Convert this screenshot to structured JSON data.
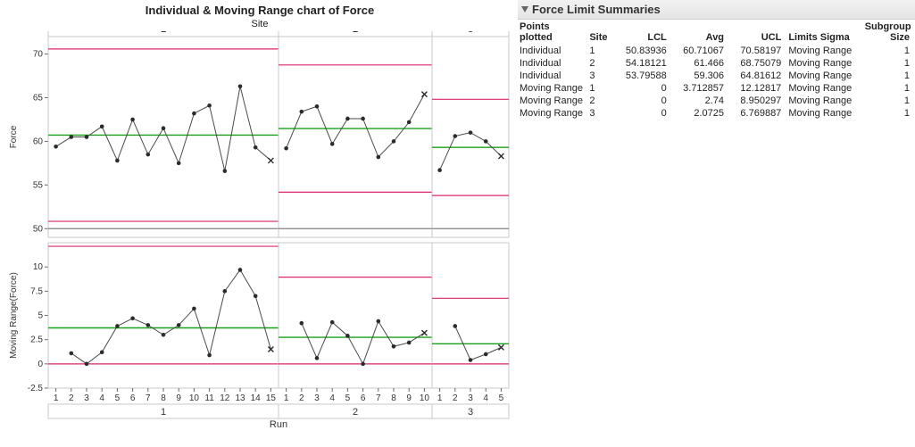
{
  "title": "Individual & Moving Range chart of Force",
  "top_group_label": "Site",
  "y_label_top": "Force",
  "y_label_bottom": "Moving Range(Force)",
  "x_label": "Run",
  "colors": {
    "limit": "#d8276d",
    "center": "#1aa01a",
    "spec": "#808080",
    "point_stroke": "#4a4a4a",
    "point_fill": "#2b2b2b",
    "axis": "#666666",
    "panel_border": "#c8c8c8"
  },
  "chart_data": {
    "type": "line",
    "rows": [
      {
        "label": "Individual",
        "ylabel": "Force",
        "ylim": [
          49,
          72
        ],
        "yticks": [
          50,
          55,
          60,
          65,
          70
        ],
        "spec_line": 50,
        "panels": [
          {
            "site": "1",
            "lcl": 50.83936,
            "avg": 60.71067,
            "ucl": 70.58197,
            "values": [
              59.4,
              60.5,
              60.5,
              61.7,
              57.8,
              62.5,
              58.5,
              61.5,
              57.5,
              63.2,
              64.1,
              56.6,
              66.3,
              59.3,
              57.8
            ]
          },
          {
            "site": "2",
            "lcl": 54.18121,
            "avg": 61.466,
            "ucl": 68.75079,
            "values": [
              59.2,
              63.4,
              64,
              59.7,
              62.6,
              62.6,
              58.2,
              60,
              62.2,
              65.4
            ]
          },
          {
            "site": "3",
            "lcl": 53.79588,
            "avg": 59.306,
            "ucl": 64.81612,
            "values": [
              56.7,
              60.6,
              61,
              60,
              58.3
            ]
          }
        ]
      },
      {
        "label": "Moving Range",
        "ylabel": "Moving Range(Force)",
        "ylim": [
          -2.5,
          12.5
        ],
        "yticks": [
          -2.5,
          0,
          2.5,
          5,
          7.5,
          10
        ],
        "spec_line": null,
        "panels": [
          {
            "site": "1",
            "lcl": 0,
            "avg": 3.712857,
            "ucl": 12.12817,
            "values": [
              1.1,
              0,
              1.2,
              3.9,
              4.7,
              4.0,
              3.0,
              4.0,
              5.7,
              0.9,
              7.5,
              9.7,
              7.0,
              1.5
            ]
          },
          {
            "site": "2",
            "lcl": 0,
            "avg": 2.74,
            "ucl": 8.950297,
            "values": [
              4.2,
              0.6,
              4.3,
              2.9,
              0,
              4.4,
              1.8,
              2.2,
              3.2
            ]
          },
          {
            "site": "3",
            "lcl": 0,
            "avg": 2.0725,
            "ucl": 6.769887,
            "values": [
              3.9,
              0.4,
              1.0,
              1.7
            ]
          }
        ]
      }
    ],
    "last_point_marker": "cross"
  },
  "summary": {
    "title": "Force Limit Summaries",
    "columns": [
      "Points plotted",
      "Site",
      "LCL",
      "Avg",
      "UCL",
      "Limits Sigma",
      "Subgroup Size"
    ],
    "rows": [
      {
        "points": "Individual",
        "site": "1",
        "lcl": "50.83936",
        "avg": "60.71067",
        "ucl": "70.58197",
        "sigma": "Moving Range",
        "n": "1"
      },
      {
        "points": "Individual",
        "site": "2",
        "lcl": "54.18121",
        "avg": "61.466",
        "ucl": "68.75079",
        "sigma": "Moving Range",
        "n": "1"
      },
      {
        "points": "Individual",
        "site": "3",
        "lcl": "53.79588",
        "avg": "59.306",
        "ucl": "64.81612",
        "sigma": "Moving Range",
        "n": "1"
      },
      {
        "points": "Moving Range",
        "site": "1",
        "lcl": "0",
        "avg": "3.712857",
        "ucl": "12.12817",
        "sigma": "Moving Range",
        "n": "1"
      },
      {
        "points": "Moving Range",
        "site": "2",
        "lcl": "0",
        "avg": "2.74",
        "ucl": "8.950297",
        "sigma": "Moving Range",
        "n": "1"
      },
      {
        "points": "Moving Range",
        "site": "3",
        "lcl": "0",
        "avg": "2.0725",
        "ucl": "6.769887",
        "sigma": "Moving Range",
        "n": "1"
      }
    ]
  }
}
